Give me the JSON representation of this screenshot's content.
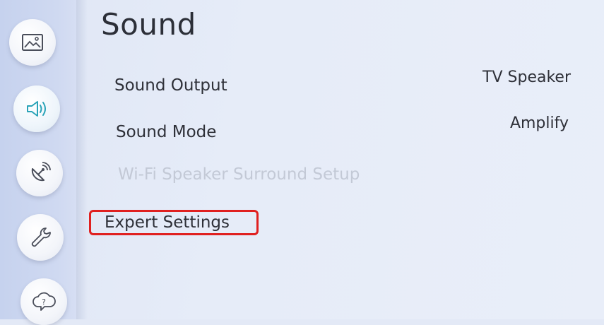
{
  "page": {
    "title": "Sound"
  },
  "sidebar": {
    "items": [
      {
        "icon": "picture-icon"
      },
      {
        "icon": "sound-icon",
        "active": true
      },
      {
        "icon": "broadcasting-icon"
      },
      {
        "icon": "wrench-icon"
      },
      {
        "icon": "support-icon"
      }
    ]
  },
  "menu": {
    "items": [
      {
        "label": "Sound Output",
        "value": "TV Speaker"
      },
      {
        "label": "Sound Mode",
        "value": "Amplify"
      },
      {
        "label": "Wi-Fi Speaker Surround Setup",
        "disabled": true
      },
      {
        "label": "Expert Settings",
        "highlighted": true
      }
    ]
  },
  "colors": {
    "highlight": "#e02020",
    "sound_icon_accent": "#2aa3b8"
  }
}
